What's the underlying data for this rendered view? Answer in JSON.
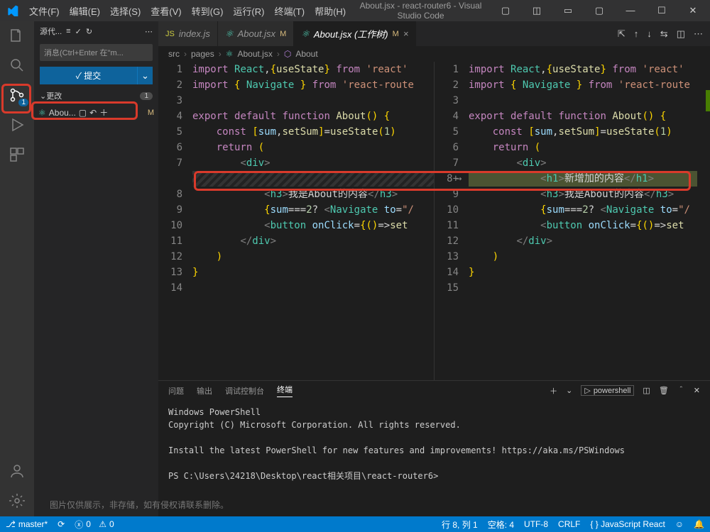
{
  "window": {
    "title": "About.jsx - react-router6 - Visual Studio Code"
  },
  "menu": [
    "文件(F)",
    "编辑(E)",
    "选择(S)",
    "查看(V)",
    "转到(G)",
    "运行(R)",
    "终端(T)",
    "帮助(H)"
  ],
  "activity": {
    "scm_badge": "1"
  },
  "sidebar": {
    "title": "源代...",
    "message_placeholder": "消息(Ctrl+Enter 在\"m...",
    "commit_label": "✓ 提交",
    "section": "更改",
    "section_count": "1",
    "file": "Abou...",
    "file_status": "M"
  },
  "tabs": [
    {
      "label": "index.js",
      "icon": "JS"
    },
    {
      "label": "About.jsx",
      "icon": "⚛",
      "status": "M"
    },
    {
      "label": "About.jsx (工作树)",
      "icon": "⚛",
      "status": "M",
      "active": true,
      "close": "×"
    }
  ],
  "breadcrumbs": [
    "src",
    "pages",
    "About.jsx",
    "About"
  ],
  "left_lines": [
    "1",
    "2",
    "3",
    "4",
    "5",
    "6",
    "7",
    "",
    "8",
    "9",
    "10",
    "11",
    "12",
    "13",
    "14"
  ],
  "right_lines": [
    "1",
    "2",
    "3",
    "4",
    "5",
    "6",
    "7",
    "8+",
    "9",
    "10",
    "11",
    "12",
    "13",
    "14",
    "15"
  ],
  "added_text": "新增加的内容",
  "about_text": "我是About的内容",
  "panel": {
    "tabs": [
      "问题",
      "输出",
      "调试控制台",
      "终端"
    ],
    "active": 3,
    "shell": "powershell",
    "lines": [
      "Windows PowerShell",
      "Copyright (C) Microsoft Corporation. All rights reserved.",
      "",
      "Install the latest PowerShell for new features and improvements! https://aka.ms/PSWindows",
      "",
      "PS C:\\Users\\24218\\Desktop\\react相关项目\\react-router6>"
    ]
  },
  "status": {
    "branch": "master*",
    "sync": "⟳",
    "errors": "0",
    "warnings": "0",
    "ln": "行 8, 列 1",
    "spaces": "空格: 4",
    "encoding": "UTF-8",
    "eol": "CRLF",
    "lang": "{ } JavaScript React",
    "feedback_icon": "☺",
    "bell_icon": "🔔"
  },
  "watermark": "图片仅供展示，非存储，如有侵权请联系删除。"
}
